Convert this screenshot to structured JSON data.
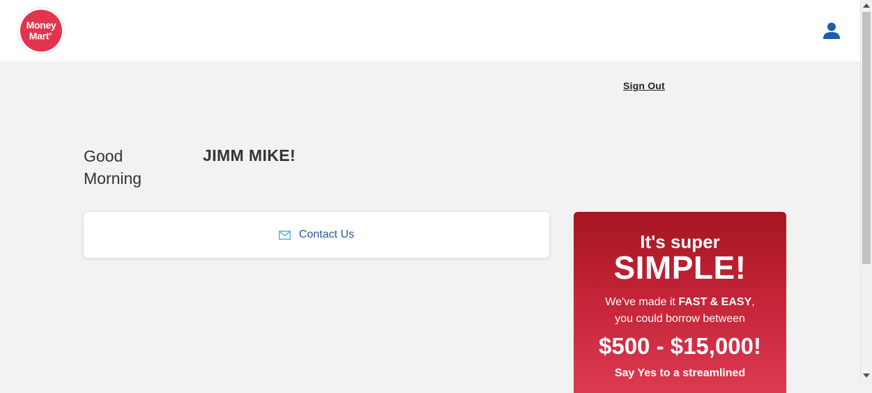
{
  "header": {
    "logo_line1": "Money",
    "logo_line2": "Mart",
    "logo_reg": "®",
    "brand_color": "#e3344d",
    "user_icon": "user-account-icon",
    "icon_color": "#1d5fa8"
  },
  "account": {
    "sign_out_label": "Sign Out"
  },
  "greeting": {
    "salutation": "Good Morning",
    "name": "JIMM MIKE!"
  },
  "contact": {
    "label": "Contact Us",
    "icon": "envelope-icon",
    "icon_color": "#5bb3d9"
  },
  "promo": {
    "headline_small": "It's super",
    "headline_large": "SIMPLE!",
    "text_part1": "We've made it ",
    "text_bold": "FAST & EASY",
    "text_part2": ",",
    "text_line2": "you could borrow between",
    "amount_range": "$500 - $15,000!",
    "tagline": "Say Yes to a streamlined",
    "gradient_top": "#a51622",
    "gradient_bottom": "#dc3a52"
  }
}
